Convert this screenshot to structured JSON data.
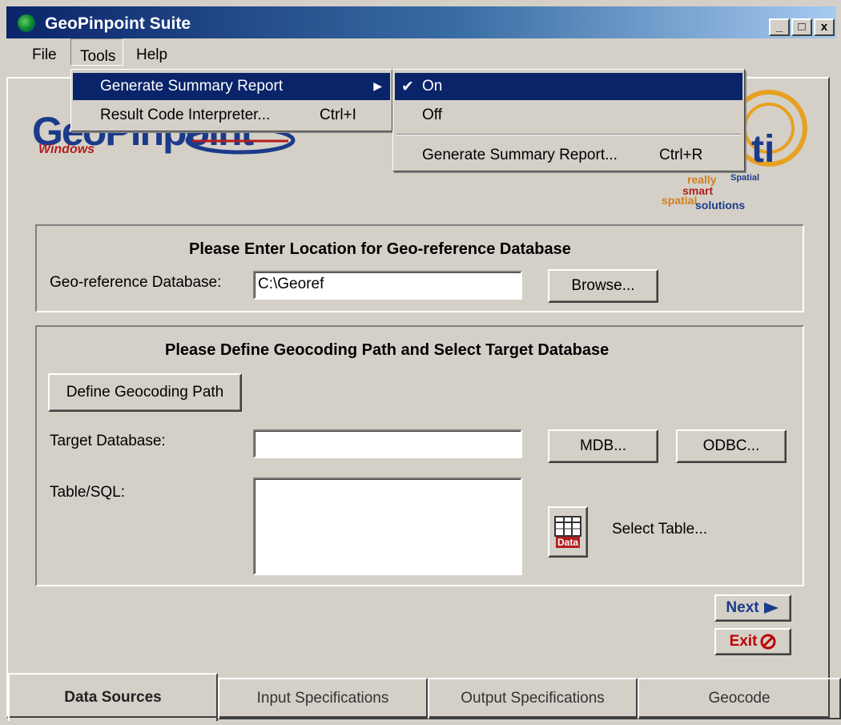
{
  "window": {
    "title": "GeoPinpoint Suite",
    "minimize": "_",
    "maximize": "□",
    "close": "x"
  },
  "menubar": {
    "file": "File",
    "tools": "Tools",
    "help": "Help"
  },
  "tools_menu": {
    "items": [
      {
        "label": "Generate Summary Report",
        "shortcut": "",
        "submenu": true
      },
      {
        "label": "Result Code Interpreter...",
        "shortcut": "Ctrl+I"
      }
    ]
  },
  "summary_submenu": {
    "on": "On",
    "off": "Off",
    "generate": "Generate Summary Report...",
    "generate_shortcut": "Ctrl+R"
  },
  "logos": {
    "brand": "GeoPinpoint",
    "windows": "Windows",
    "tag_really": "really",
    "tag_spatial": "Spatial",
    "tag_smart": "smart",
    "tag_spatial2": "spatial",
    "tag_solutions": "solutions"
  },
  "georef": {
    "title": "Please Enter Location for Geo-reference Database",
    "label": "Geo-reference Database:",
    "value": "C:\\Georef",
    "browse": "Browse..."
  },
  "geocoding": {
    "title": "Please Define Geocoding Path and Select Target Database",
    "define_button": "Define Geocoding Path",
    "target_label": "Target Database:",
    "target_value": "",
    "mdb": "MDB...",
    "odbc": "ODBC...",
    "table_label": "Table/SQL:",
    "table_value": "",
    "data_icon_text": "Data",
    "select_table": "Select Table..."
  },
  "nav": {
    "next": "Next",
    "exit": "Exit"
  },
  "tabs": [
    {
      "label": "Data Sources"
    },
    {
      "label": "Input Specifications"
    },
    {
      "label": "Output Specifications"
    },
    {
      "label": "Geocode"
    }
  ],
  "colors": {
    "titlebar": "#0a246a",
    "highlight": "#0a246a",
    "face": "#d4d0c8",
    "exit_red": "#c00000",
    "next_blue": "#1b3b8a"
  }
}
